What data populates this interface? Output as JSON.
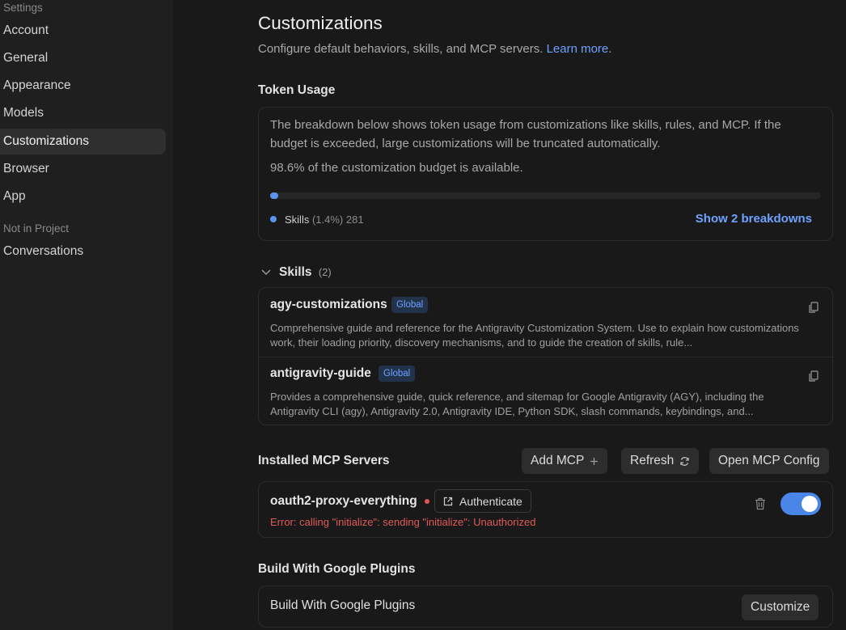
{
  "sidebar": {
    "settings_heading": "Settings",
    "items": [
      {
        "label": "Account"
      },
      {
        "label": "General"
      },
      {
        "label": "Appearance"
      },
      {
        "label": "Models"
      },
      {
        "label": "Customizations"
      },
      {
        "label": "Browser"
      },
      {
        "label": "App"
      }
    ],
    "project_heading": "Not in Project",
    "project_items": [
      {
        "label": "Conversations"
      }
    ]
  },
  "page": {
    "title": "Customizations",
    "subtitle": "Configure default behaviors, skills, and MCP servers.",
    "learn_more": "Learn more",
    "period": "."
  },
  "token_usage": {
    "title": "Token Usage",
    "description": "The breakdown below shows token usage from customizations like skills, rules, and MCP. If the budget is exceeded, large customizations will be truncated automatically.",
    "available_text": "98.6% of the customization budget is available.",
    "used_fraction": 0.014,
    "legend_label": "Skills",
    "legend_value": "(1.4%) 281",
    "accent_color": "#5a94f0",
    "show_breakdowns": "Show 2 breakdowns"
  },
  "skills": {
    "title": "Skills",
    "count": "(2)",
    "items": [
      {
        "name": "agy-customizations",
        "badge": "Global",
        "description": "Comprehensive guide and reference for the Antigravity Customization System. Use to explain how customizations work, their loading priority, discovery mechanisms, and to guide the creation of skills, rule..."
      },
      {
        "name": "antigravity-guide",
        "badge": "Global",
        "description": "Provides a comprehensive guide, quick reference, and sitemap for Google Antigravity (AGY), including the Antigravity CLI (agy), Antigravity 2.0, Antigravity IDE, Python SDK, slash commands, keybindings, and..."
      }
    ]
  },
  "mcp": {
    "title": "Installed MCP Servers",
    "add_label": "Add MCP",
    "refresh_label": "Refresh",
    "open_config_label": "Open MCP Config",
    "servers": [
      {
        "name": "oauth2-proxy-everything",
        "auth_label": "Authenticate",
        "error": "Error: calling \"initialize\": sending \"initialize\": Unauthorized",
        "enabled": true
      }
    ]
  },
  "plugins": {
    "title": "Build With Google Plugins",
    "row_label": "Build With Google Plugins",
    "customize_label": "Customize"
  },
  "icons": {
    "copy": "copy-icon",
    "chevron": "chevron-down-icon",
    "plus": "plus-icon",
    "refresh": "refresh-icon",
    "external": "external-link-icon",
    "trash": "trash-icon"
  }
}
